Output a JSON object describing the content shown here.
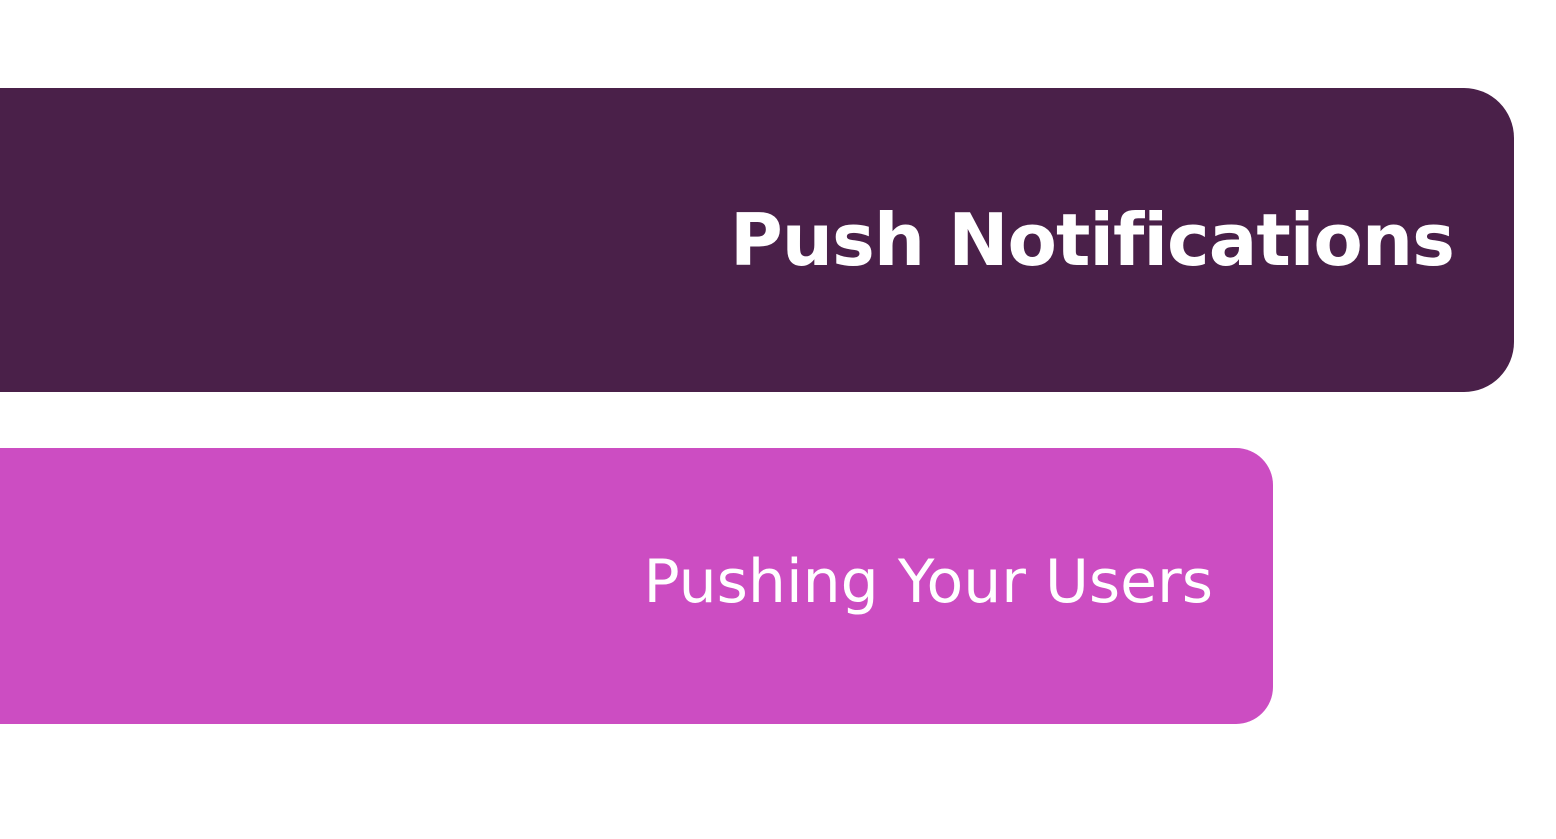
{
  "slide": {
    "title": "Push Notifications",
    "subtitle": "Pushing Your Users"
  },
  "colors": {
    "title_banner": "#4a2049",
    "subtitle_banner": "#cc4dc2",
    "text": "#ffffff",
    "background": "#ffffff"
  }
}
